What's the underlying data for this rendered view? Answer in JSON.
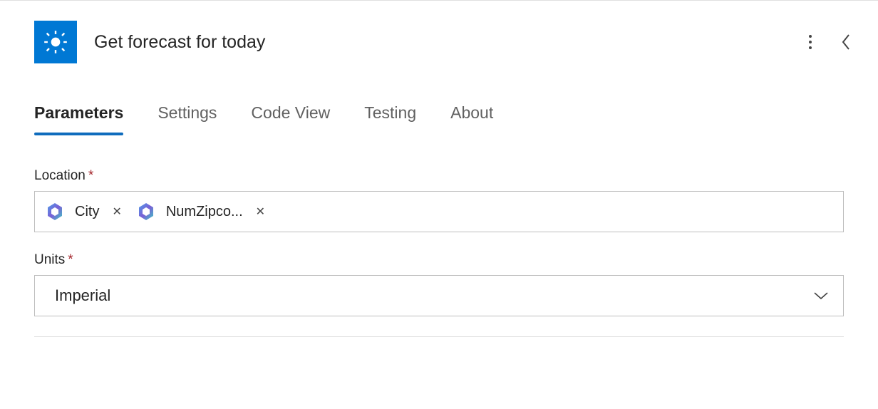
{
  "header": {
    "title": "Get forecast for today",
    "icon": "sun-icon"
  },
  "tabs": [
    {
      "label": "Parameters",
      "active": true
    },
    {
      "label": "Settings",
      "active": false
    },
    {
      "label": "Code View",
      "active": false
    },
    {
      "label": "Testing",
      "active": false
    },
    {
      "label": "About",
      "active": false
    }
  ],
  "fields": {
    "location": {
      "label": "Location",
      "required": true,
      "tokens": [
        {
          "label": "City"
        },
        {
          "label": "NumZipco..."
        }
      ]
    },
    "units": {
      "label": "Units",
      "required": true,
      "value": "Imperial"
    }
  }
}
